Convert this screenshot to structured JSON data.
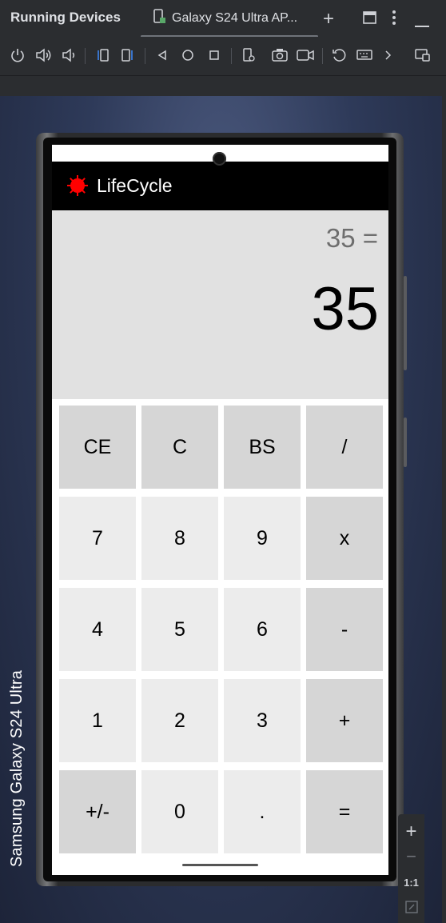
{
  "window": {
    "panel_title": "Running Devices",
    "tab_title": "Galaxy S24 Ultra AP..."
  },
  "toolbar": {
    "icons": [
      "power-icon",
      "volume-up-icon",
      "volume-down-icon",
      "rotate-left-icon",
      "rotate-right-icon",
      "back-icon",
      "home-icon",
      "overview-icon",
      "device-settings-icon",
      "screenshot-icon",
      "screen-record-icon",
      "reset-icon",
      "keyboard-icon",
      "more-icon",
      "device-mirror-icon"
    ]
  },
  "device": {
    "label": "Samsung Galaxy  S24 Ultra"
  },
  "app": {
    "title": "LifeCycle",
    "icon": "virus-icon",
    "icon_color": "#ff0000"
  },
  "calculator": {
    "expression": "35 =",
    "result": "35",
    "keys": [
      {
        "label": "CE",
        "style": "dark"
      },
      {
        "label": "C",
        "style": "dark"
      },
      {
        "label": "BS",
        "style": "dark"
      },
      {
        "label": "/",
        "style": "dark"
      },
      {
        "label": "7",
        "style": "light"
      },
      {
        "label": "8",
        "style": "light"
      },
      {
        "label": "9",
        "style": "light"
      },
      {
        "label": "x",
        "style": "dark"
      },
      {
        "label": "4",
        "style": "light"
      },
      {
        "label": "5",
        "style": "light"
      },
      {
        "label": "6",
        "style": "light"
      },
      {
        "label": "-",
        "style": "dark"
      },
      {
        "label": "1",
        "style": "light"
      },
      {
        "label": "2",
        "style": "light"
      },
      {
        "label": "3",
        "style": "light"
      },
      {
        "label": "+",
        "style": "dark"
      },
      {
        "label": "+/-",
        "style": "dark"
      },
      {
        "label": "0",
        "style": "light"
      },
      {
        "label": ".",
        "style": "light"
      },
      {
        "label": "=",
        "style": "dark"
      }
    ]
  },
  "zoom": {
    "zoom_in": "+",
    "zoom_out": "−",
    "actual_size": "1:1"
  },
  "colors": {
    "ide_bg": "#2b2d30",
    "display_bg": "#e1e1e1",
    "key_dark": "#d6d6d6",
    "key_light": "#ececec",
    "appbar_bg": "#000000"
  }
}
